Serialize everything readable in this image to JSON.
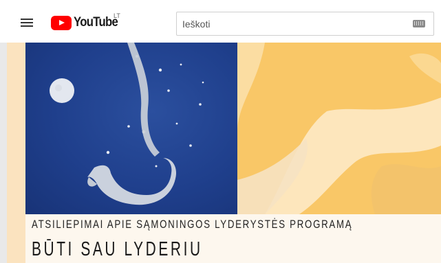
{
  "header": {
    "logo_text": "YouTube",
    "region": "LT",
    "icons": {
      "menu": "hamburger-icon",
      "logo": "youtube-logo-icon",
      "keyboard": "keyboard-icon"
    }
  },
  "search": {
    "placeholder": "Ieškoti",
    "value": ""
  },
  "video": {
    "subtitle": "ATSILIEPIMAI APIE SĄMONINGOS LYDERYSTĖS PROGRAMĄ",
    "title": "BŪTI SAU LYDERIU"
  },
  "colors": {
    "brand": "#ff0000",
    "panel_blue": "#1f3f8c",
    "panel_yellow": "#f9c767",
    "strip": "#fdf7ee"
  }
}
